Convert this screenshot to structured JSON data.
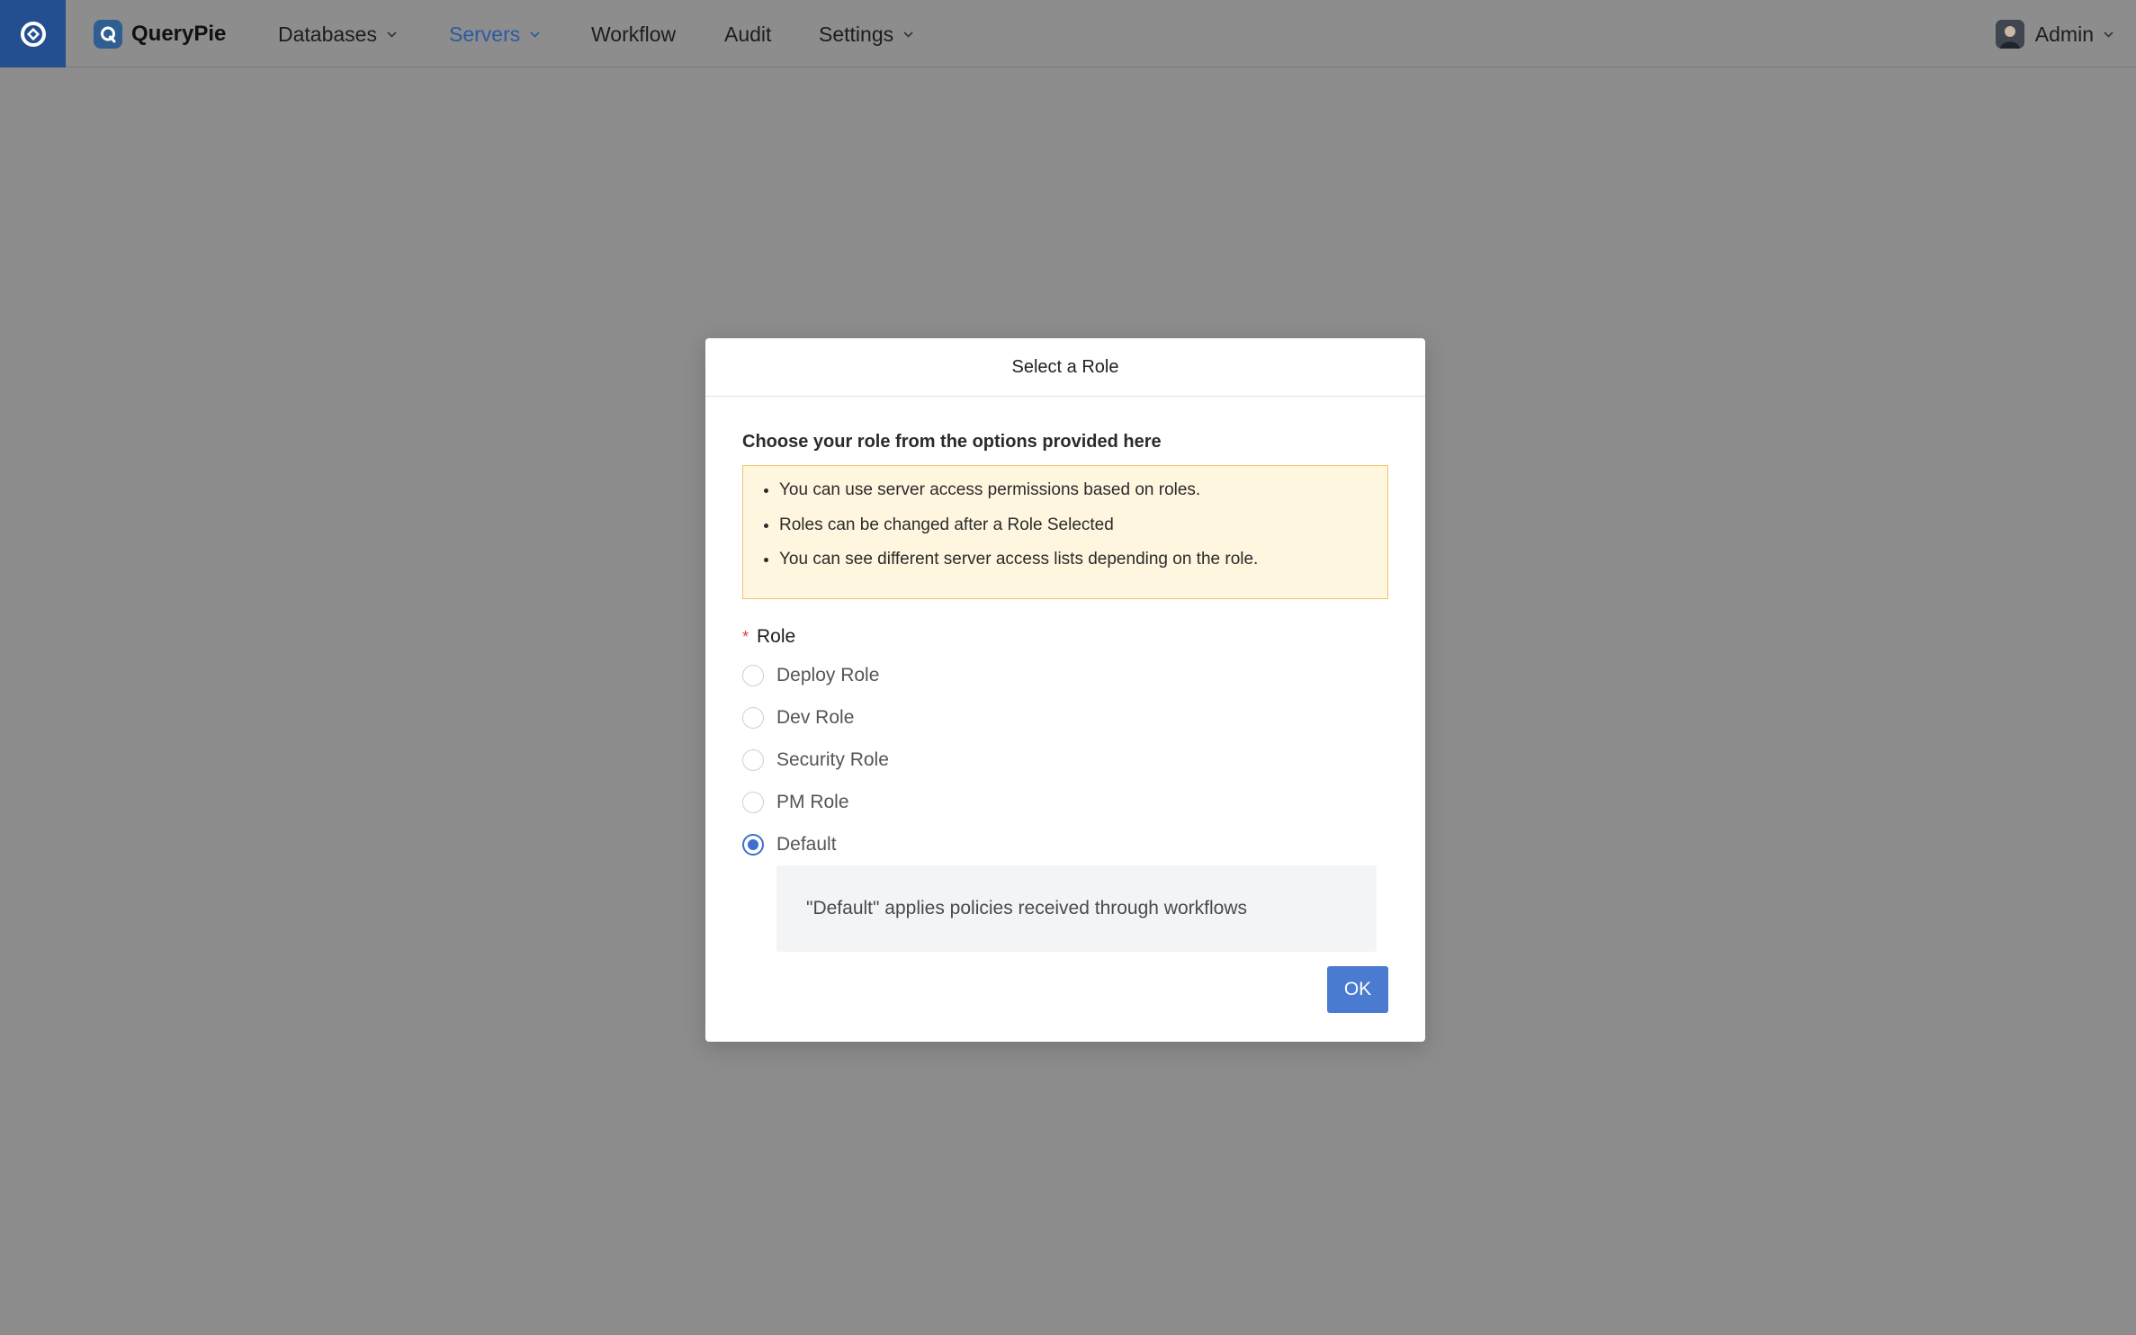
{
  "app": {
    "name": "QueryPie"
  },
  "nav": {
    "items": [
      {
        "label": "Databases",
        "has_dropdown": true,
        "active": false
      },
      {
        "label": "Servers",
        "has_dropdown": true,
        "active": true
      },
      {
        "label": "Workflow",
        "has_dropdown": false,
        "active": false
      },
      {
        "label": "Audit",
        "has_dropdown": false,
        "active": false
      },
      {
        "label": "Settings",
        "has_dropdown": true,
        "active": false
      }
    ],
    "user": {
      "name": "Admin"
    }
  },
  "modal": {
    "title": "Select a Role",
    "intro": "Choose your role from the options provided here",
    "notice": [
      "You can use server access permissions based on roles.",
      "Roles can be changed after a Role Selected",
      "You can see different server access lists depending on the role."
    ],
    "role_label": "Role",
    "required_mark": "*",
    "options": [
      {
        "label": "Deploy Role",
        "selected": false
      },
      {
        "label": "Dev Role",
        "selected": false
      },
      {
        "label": "Security Role",
        "selected": false
      },
      {
        "label": "PM Role",
        "selected": false
      },
      {
        "label": "Default",
        "selected": true
      }
    ],
    "default_description": "\"Default\" applies policies received through workflows",
    "ok_label": "OK"
  },
  "colors": {
    "accent": "#4a7bd1",
    "active_nav": "#2c5aa3",
    "brand_tile": "#234e8f",
    "notice_bg": "#fff6df",
    "notice_border": "#f0c66b",
    "required": "#e0413a",
    "overlay": "#8c8c8c"
  },
  "icons": {
    "brand": "querypie-brand-icon",
    "logo": "querypie-logo-icon",
    "dropdown": "chevron-down-icon",
    "avatar": "user-avatar-icon"
  }
}
